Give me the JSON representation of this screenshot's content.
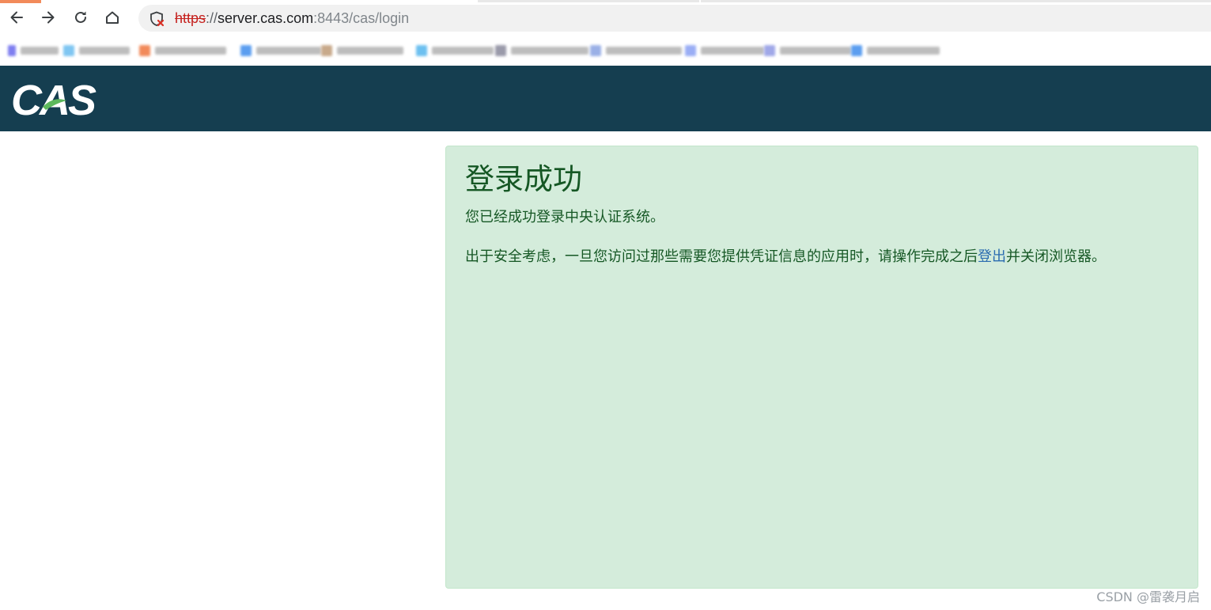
{
  "browser": {
    "address_bar": {
      "scheme": "https",
      "separator": "://",
      "host": "server.cas.com",
      "path": ":8443/cas/login"
    },
    "icons": {
      "back": "arrow-left-icon",
      "forward": "arrow-right-icon",
      "reload": "reload-icon",
      "home": "home-icon",
      "security": "not-secure-shield-icon"
    }
  },
  "header": {
    "logo_text": "CAS",
    "background": "#153e50"
  },
  "alert": {
    "title": "登录成功",
    "message": "您已经成功登录中央认证系统。",
    "security_text_before": "出于安全考虑，一旦您访问过那些需要您提供凭证信息的应用时，请操作完成之后",
    "logout_link": "登出",
    "security_text_after": "并关闭浏览器。",
    "background": "#d4ecdb",
    "text_color": "#155724"
  },
  "watermark": "CSDN @雷袭月启"
}
